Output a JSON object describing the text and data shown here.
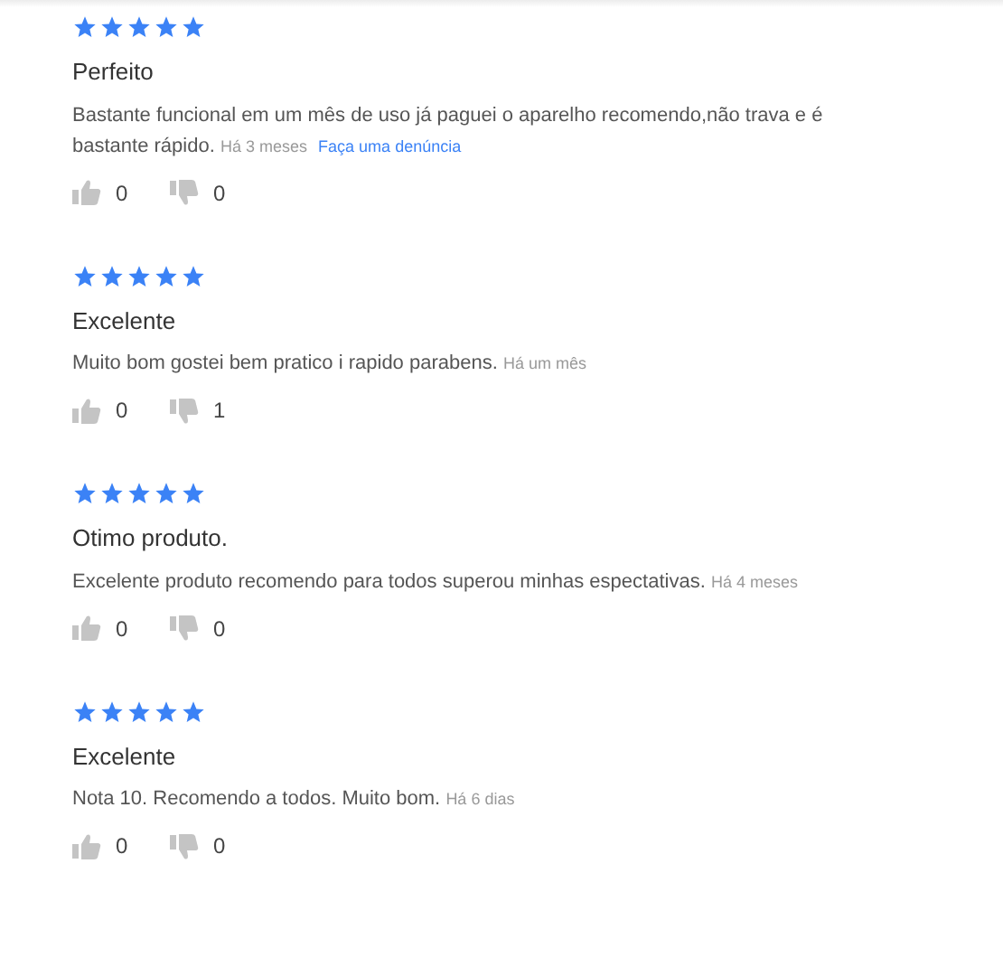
{
  "reviews": [
    {
      "stars": 5,
      "title": "Perfeito",
      "body": "Bastante funcional em um mês de uso já paguei o aparelho recomendo,não trava e é bastante rápido.",
      "time": "Há 3 meses",
      "report_link": "Faça uma denúncia",
      "likes": "0",
      "dislikes": "0"
    },
    {
      "stars": 5,
      "title": "Excelente",
      "body": "Muito bom gostei bem pratico i rapido parabens.",
      "time": "Há um mês",
      "likes": "0",
      "dislikes": "1"
    },
    {
      "stars": 5,
      "title": "Otimo produto.",
      "body": "Excelente produto recomendo para todos superou minhas espectativas.",
      "time": "Há 4 meses",
      "likes": "0",
      "dislikes": "0"
    },
    {
      "stars": 5,
      "title": "Excelente",
      "body": "Nota 10. Recomendo a todos. Muito bom.",
      "time": "Há 6 dias",
      "likes": "0",
      "dislikes": "0"
    }
  ]
}
